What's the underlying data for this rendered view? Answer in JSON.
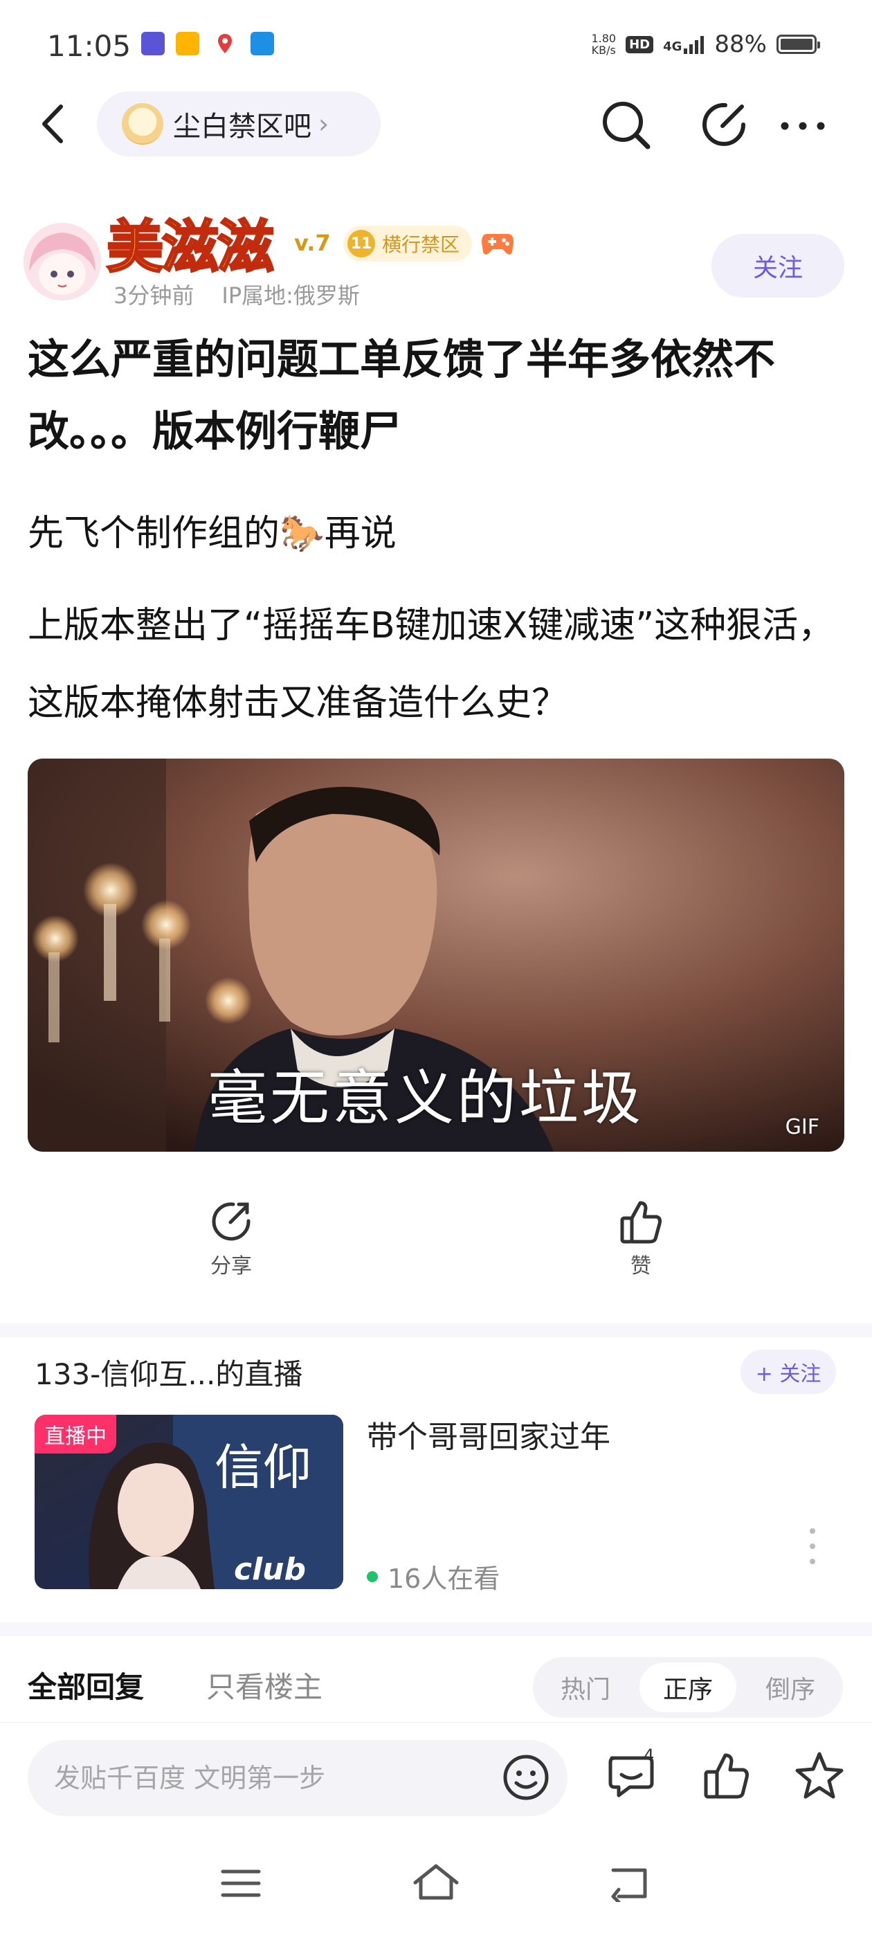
{
  "status_bar": {
    "time": "11:05",
    "net_speed_value": "1.80",
    "net_speed_unit": "KB/s",
    "hd": "HD",
    "network": "4G",
    "battery": "88%"
  },
  "nav": {
    "forum_name": "尘白禁区吧",
    "chevron": "›"
  },
  "author": {
    "name": "美滋滋",
    "level": "v.7",
    "badge_number": "11",
    "badge_text": "横行禁区",
    "time_ago": "3分钟前",
    "ip_location": "IP属地:俄罗斯",
    "follow_label": "关注"
  },
  "post": {
    "title": "这么严重的问题工单反馈了半年多依然不改。。。版本例行鞭尸",
    "line1": "先飞个制作组的🐎再说",
    "body": "上版本整出了“摇摇车B键加速X键减速”这种狠活，这版本掩体射击又准备造什么史？",
    "gif_caption": "毫无意义的垃圾",
    "gif_badge": "GIF"
  },
  "actions": {
    "share_label": "分享",
    "like_label": "赞"
  },
  "live": {
    "title": "133-信仰互...的直播",
    "follow_label": "+ 关注",
    "badge": "直播中",
    "room_title": "带个哥哥回家过年",
    "viewers": "16人在看",
    "thumb_text": "信仰",
    "thumb_sub": "club"
  },
  "replies": {
    "tab_all": "全部回复",
    "tab_owner": "只看楼主",
    "sort_hot": "热门",
    "sort_asc": "正序",
    "sort_desc": "倒序",
    "active_sort": "正序"
  },
  "bottom_bar": {
    "input_placeholder": "发贴千百度 文明第一步",
    "reply_count": "4"
  },
  "colors": {
    "accent": "#6e5ce0",
    "live_badge": "#ff2f6a",
    "live_dot": "#1ec36b"
  }
}
